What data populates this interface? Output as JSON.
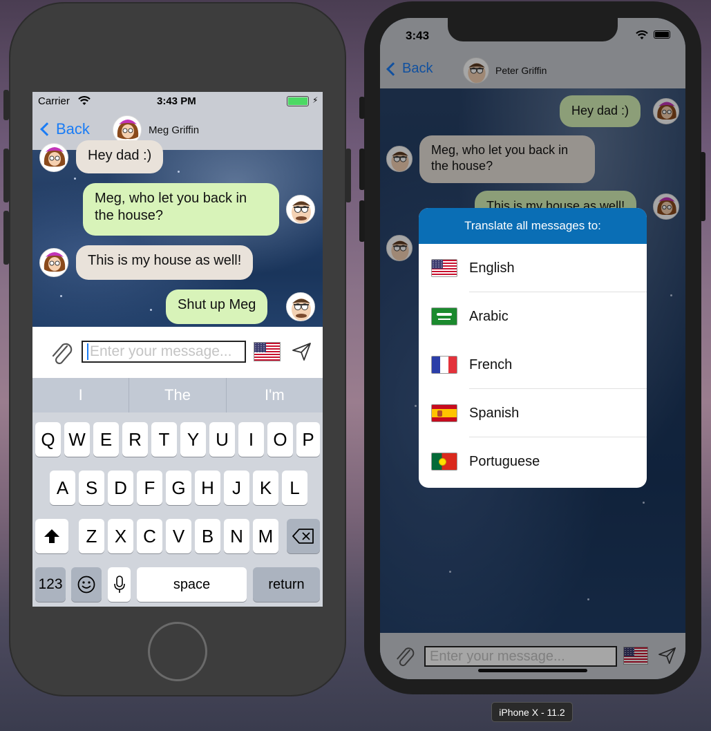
{
  "left_device": {
    "status": {
      "carrier": "Carrier",
      "time": "3:43 PM"
    },
    "nav": {
      "back_label": "Back",
      "contact_name": "Meg Griffin"
    },
    "messages": [
      {
        "text": "Hey dad :)",
        "from": "contact"
      },
      {
        "text": "Meg, who let you back in the house?",
        "from": "me"
      },
      {
        "text": "This is my house as well!",
        "from": "contact"
      },
      {
        "text": "Shut up Meg",
        "from": "me"
      }
    ],
    "input": {
      "placeholder": "Enter your message..."
    },
    "suggestions": [
      "I",
      "The",
      "I'm"
    ],
    "keyboard": {
      "row1": [
        "Q",
        "W",
        "E",
        "R",
        "T",
        "Y",
        "U",
        "I",
        "O",
        "P"
      ],
      "row2": [
        "A",
        "S",
        "D",
        "F",
        "G",
        "H",
        "J",
        "K",
        "L"
      ],
      "row3": [
        "Z",
        "X",
        "C",
        "V",
        "B",
        "N",
        "M"
      ],
      "numbers_label": "123",
      "space_label": "space",
      "return_label": "return"
    }
  },
  "right_device": {
    "status": {
      "time": "3:43"
    },
    "nav": {
      "back_label": "Back",
      "contact_name": "Peter Griffin"
    },
    "messages": [
      {
        "text": "Hey dad :)",
        "from": "me"
      },
      {
        "text": "Meg, who let you back in the house?",
        "from": "contact"
      },
      {
        "text": "This is my house as well!",
        "from": "me"
      }
    ],
    "translate_sheet": {
      "title": "Translate all messages to:",
      "languages": [
        {
          "name": "English",
          "flag": "us-flag"
        },
        {
          "name": "Arabic",
          "flag": "saudi-flag"
        },
        {
          "name": "French",
          "flag": "france-flag"
        },
        {
          "name": "Spanish",
          "flag": "spain-flag"
        },
        {
          "name": "Portuguese",
          "flag": "portugal-flag"
        }
      ]
    },
    "input": {
      "placeholder": "Enter your message..."
    }
  },
  "simulator_label": "iPhone X - 11.2",
  "colors": {
    "accent_blue": "#1a7cf5",
    "outgoing_bubble": "#d8f3b9",
    "incoming_bubble": "#e9e2da",
    "sheet_header": "#0a6eb5"
  }
}
